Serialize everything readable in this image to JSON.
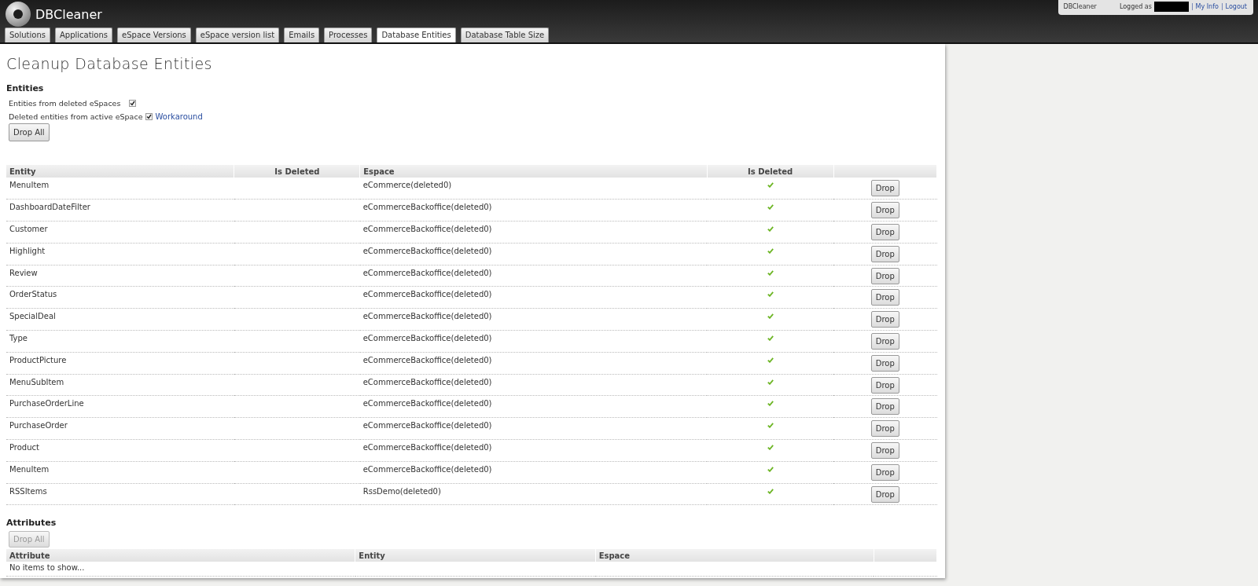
{
  "app": {
    "name": "DBCleaner"
  },
  "user_bar": {
    "app": "DBCleaner",
    "logged_as": "Logged as",
    "separator": "|",
    "links": [
      "My Info",
      "Logout"
    ]
  },
  "tabs": [
    {
      "label": "Solutions",
      "selected": false
    },
    {
      "label": "Applications",
      "selected": false
    },
    {
      "label": "eSpace Versions",
      "selected": false
    },
    {
      "label": "eSpace version list",
      "selected": false
    },
    {
      "label": "Emails",
      "selected": false
    },
    {
      "label": "Processes",
      "selected": false
    },
    {
      "label": "Database Entities",
      "selected": true
    },
    {
      "label": "Database Table Size",
      "selected": false
    }
  ],
  "page_title": "Cleanup Database Entities",
  "entities": {
    "heading": "Entities",
    "options": [
      {
        "label": "Entities from deleted eSpaces",
        "checked": true
      },
      {
        "label": "Deleted entities from active eSpace",
        "checked": true,
        "link": "Workaround"
      }
    ],
    "drop_all": {
      "label": "Drop All",
      "disabled": false
    },
    "columns": [
      "Entity",
      "Is Deleted",
      "Espace",
      "Is Deleted"
    ],
    "rows": [
      {
        "entity": "MenuItem",
        "espace": "eCommerce(deleted0)",
        "deleted": true,
        "action": "Drop"
      },
      {
        "entity": "DashboardDateFilter",
        "espace": "eCommerceBackoffice(deleted0)",
        "deleted": true,
        "action": "Drop"
      },
      {
        "entity": "Customer",
        "espace": "eCommerceBackoffice(deleted0)",
        "deleted": true,
        "action": "Drop"
      },
      {
        "entity": "Highlight",
        "espace": "eCommerceBackoffice(deleted0)",
        "deleted": true,
        "action": "Drop"
      },
      {
        "entity": "Review",
        "espace": "eCommerceBackoffice(deleted0)",
        "deleted": true,
        "action": "Drop"
      },
      {
        "entity": "OrderStatus",
        "espace": "eCommerceBackoffice(deleted0)",
        "deleted": true,
        "action": "Drop"
      },
      {
        "entity": "SpecialDeal",
        "espace": "eCommerceBackoffice(deleted0)",
        "deleted": true,
        "action": "Drop"
      },
      {
        "entity": "Type",
        "espace": "eCommerceBackoffice(deleted0)",
        "deleted": true,
        "action": "Drop"
      },
      {
        "entity": "ProductPicture",
        "espace": "eCommerceBackoffice(deleted0)",
        "deleted": true,
        "action": "Drop"
      },
      {
        "entity": "MenuSubItem",
        "espace": "eCommerceBackoffice(deleted0)",
        "deleted": true,
        "action": "Drop"
      },
      {
        "entity": "PurchaseOrderLine",
        "espace": "eCommerceBackoffice(deleted0)",
        "deleted": true,
        "action": "Drop"
      },
      {
        "entity": "PurchaseOrder",
        "espace": "eCommerceBackoffice(deleted0)",
        "deleted": true,
        "action": "Drop"
      },
      {
        "entity": "Product",
        "espace": "eCommerceBackoffice(deleted0)",
        "deleted": true,
        "action": "Drop"
      },
      {
        "entity": "MenuItem",
        "espace": "eCommerceBackoffice(deleted0)",
        "deleted": true,
        "action": "Drop"
      },
      {
        "entity": "RSSItems",
        "espace": "RssDemo(deleted0)",
        "deleted": true,
        "action": "Drop"
      }
    ]
  },
  "attributes": {
    "heading": "Attributes",
    "drop_all": {
      "label": "Drop All",
      "disabled": true
    },
    "columns": [
      "Attribute",
      "Entity",
      "Espace"
    ],
    "empty": "No items to show..."
  }
}
